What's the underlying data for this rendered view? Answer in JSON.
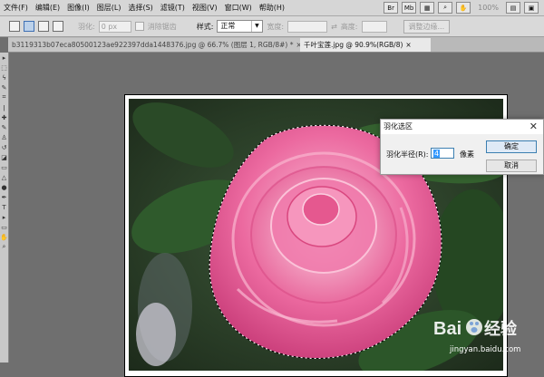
{
  "menu": {
    "items": [
      "文件(F)",
      "编辑(E)",
      "图像(I)",
      "图层(L)",
      "选择(S)",
      "滤镜(T)",
      "视图(V)",
      "窗口(W)",
      "帮助(H)"
    ],
    "zoom": "100%"
  },
  "options": {
    "feather_label": "羽化:",
    "feather_value": "0 px",
    "antialias_label": "消除锯齿",
    "style_label": "样式:",
    "style_value": "正常",
    "width_label": "宽度:",
    "height_label": "高度:",
    "refine_button": "调整边缘..."
  },
  "tabs": [
    {
      "label": "b3119313b07eca80500123ae922397dda1448376.jpg @ 66.7% (图层 1, RGB/8#) *",
      "close": "×"
    },
    {
      "label": "千叶宝莲.jpg @ 90.9%(RGB/8)",
      "close": "×"
    }
  ],
  "dialog": {
    "title": "羽化选区",
    "close": "✕",
    "radius_label": "羽化半径(R):",
    "radius_value": "4",
    "unit": "像素",
    "ok_label": "确定",
    "cancel_label": "取消"
  },
  "watermark": {
    "brand": "Bai",
    "brand_tail": "经验",
    "url": "jingyan.baidu.com"
  }
}
